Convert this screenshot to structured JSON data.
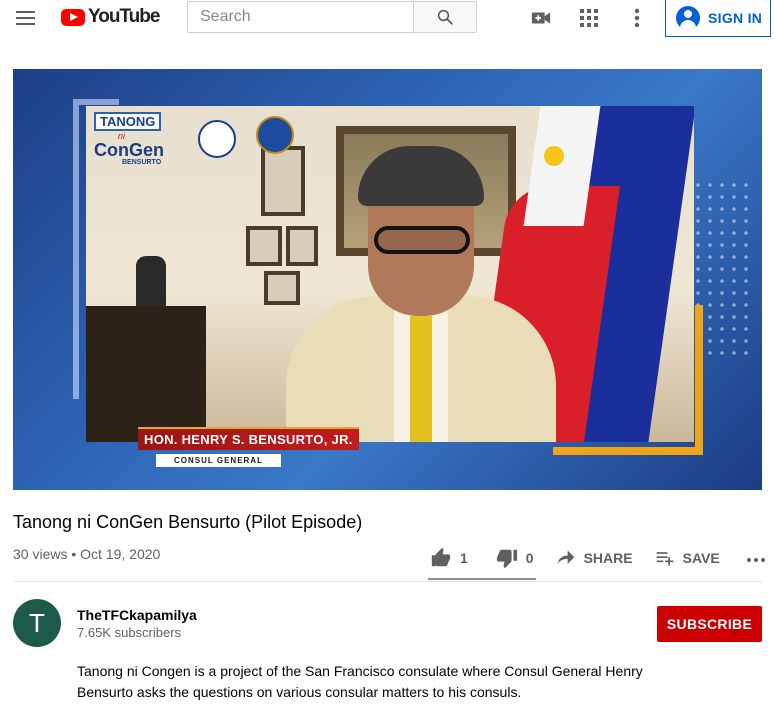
{
  "header": {
    "logo_text": "YouTube",
    "search_placeholder": "Search",
    "search_value": "",
    "signin_label": "SIGN IN",
    "icons": [
      "menu-icon",
      "search-icon",
      "create-video-icon",
      "apps-grid-icon",
      "more-vert-icon",
      "account-icon"
    ]
  },
  "player": {
    "show_title_line1": "TANONG",
    "show_title_line2": "ni",
    "show_title_line3": "ConGen",
    "show_title_line4": "BENSURTO",
    "lower_third_name": "HON. HENRY S. BENSURTO, JR.",
    "lower_third_role": "CONSUL GENERAL"
  },
  "video": {
    "title": "Tanong ni ConGen Bensurto (Pilot Episode)",
    "meta": "30 views • Oct 19, 2020",
    "likes": "1",
    "dislikes": "0",
    "share_label": "SHARE",
    "save_label": "SAVE",
    "like_ratio": 1.0
  },
  "channel": {
    "avatar_letter": "T",
    "name": "TheTFCkapamilya",
    "subscribers": "7.65K subscribers",
    "subscribe_label": "SUBSCRIBE"
  },
  "description": "Tanong ni Congen is a project of the San Francisco consulate where Consul General Henry Bensurto asks the questions on various consular matters to his consuls.",
  "colors": {
    "brand_red": "#ff0000",
    "subscribe_red": "#cc0000",
    "link_blue": "#065fd4",
    "secondary_text": "#606060",
    "avatar_green": "#1d5a49"
  }
}
